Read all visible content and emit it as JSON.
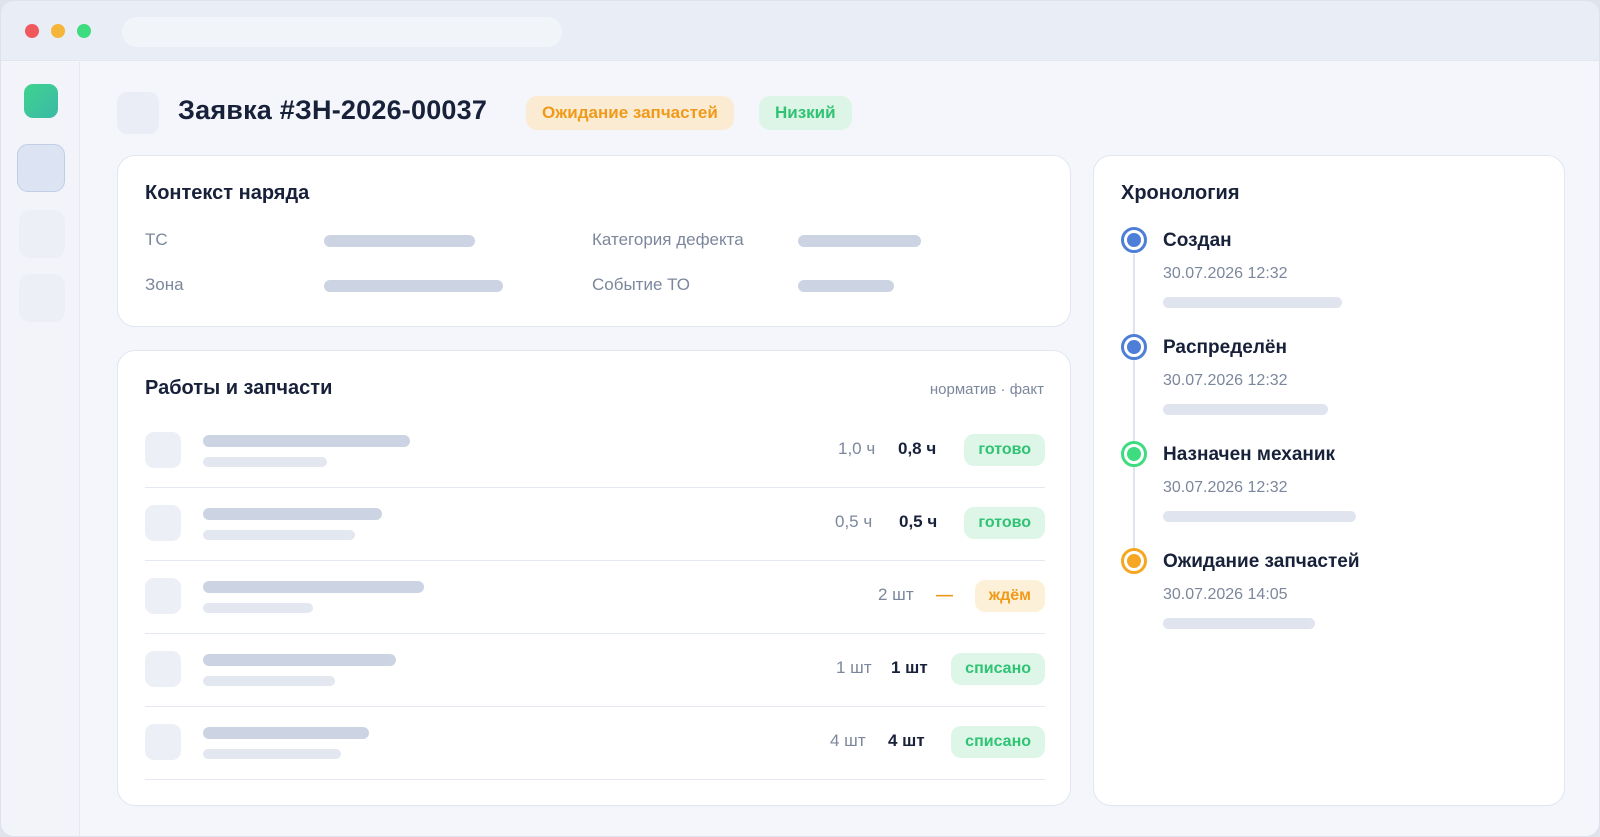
{
  "window": {
    "controls": [
      "close",
      "minimize",
      "maximize"
    ]
  },
  "header": {
    "title": "Заявка #ЗН-2026-00037",
    "status_badge": "Ожидание запчастей",
    "priority_badge": "Низкий",
    "colors": {
      "status": "#ef9a1a",
      "priority": "#2fc373"
    }
  },
  "context": {
    "title": "Контекст наряда",
    "fields": [
      {
        "label": "ТС"
      },
      {
        "label": "Категория дефекта"
      },
      {
        "label": "Зона"
      },
      {
        "label": "Событие ТО"
      }
    ]
  },
  "works": {
    "title": "Работы и запчасти",
    "columns_hint": "норматив · факт",
    "rows": [
      {
        "norm": "1,0 ч",
        "fact": "0,8 ч",
        "status": "готово"
      },
      {
        "norm": "0,5 ч",
        "fact": "0,5 ч",
        "status": "готово"
      },
      {
        "norm": "2 шт",
        "fact": "—",
        "status": "ждём"
      },
      {
        "norm": "1 шт",
        "fact": "1 шт",
        "status": "списано"
      },
      {
        "norm": "4 шт",
        "fact": "4 шт",
        "status": "списано"
      }
    ]
  },
  "timeline": {
    "title": "Хронология",
    "events": [
      {
        "title": "Создан",
        "time": "30.07.2026 12:32",
        "color": "#4d7ed8"
      },
      {
        "title": "Распределён",
        "time": "30.07.2026 12:32",
        "color": "#4d7ed8"
      },
      {
        "title": "Назначен механик",
        "time": "30.07.2026 12:32",
        "color": "#3ddc7f"
      },
      {
        "title": "Ожидание запчастей",
        "time": "30.07.2026 14:05",
        "color": "#f5a623"
      }
    ]
  }
}
